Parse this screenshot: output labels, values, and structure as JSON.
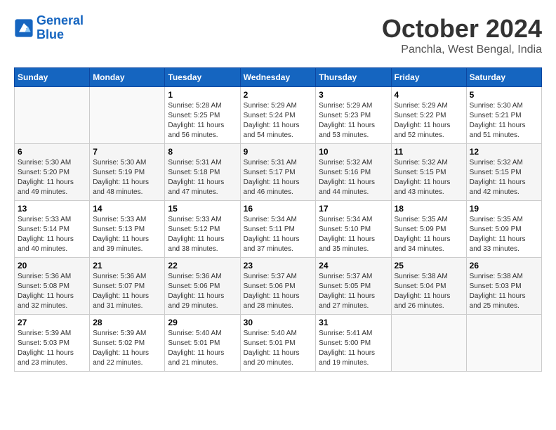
{
  "header": {
    "logo_line1": "General",
    "logo_line2": "Blue",
    "month": "October 2024",
    "location": "Panchla, West Bengal, India"
  },
  "weekdays": [
    "Sunday",
    "Monday",
    "Tuesday",
    "Wednesday",
    "Thursday",
    "Friday",
    "Saturday"
  ],
  "weeks": [
    [
      {
        "day": "",
        "sunrise": "",
        "sunset": "",
        "daylight": ""
      },
      {
        "day": "",
        "sunrise": "",
        "sunset": "",
        "daylight": ""
      },
      {
        "day": "1",
        "sunrise": "Sunrise: 5:28 AM",
        "sunset": "Sunset: 5:25 PM",
        "daylight": "Daylight: 11 hours and 56 minutes."
      },
      {
        "day": "2",
        "sunrise": "Sunrise: 5:29 AM",
        "sunset": "Sunset: 5:24 PM",
        "daylight": "Daylight: 11 hours and 54 minutes."
      },
      {
        "day": "3",
        "sunrise": "Sunrise: 5:29 AM",
        "sunset": "Sunset: 5:23 PM",
        "daylight": "Daylight: 11 hours and 53 minutes."
      },
      {
        "day": "4",
        "sunrise": "Sunrise: 5:29 AM",
        "sunset": "Sunset: 5:22 PM",
        "daylight": "Daylight: 11 hours and 52 minutes."
      },
      {
        "day": "5",
        "sunrise": "Sunrise: 5:30 AM",
        "sunset": "Sunset: 5:21 PM",
        "daylight": "Daylight: 11 hours and 51 minutes."
      }
    ],
    [
      {
        "day": "6",
        "sunrise": "Sunrise: 5:30 AM",
        "sunset": "Sunset: 5:20 PM",
        "daylight": "Daylight: 11 hours and 49 minutes."
      },
      {
        "day": "7",
        "sunrise": "Sunrise: 5:30 AM",
        "sunset": "Sunset: 5:19 PM",
        "daylight": "Daylight: 11 hours and 48 minutes."
      },
      {
        "day": "8",
        "sunrise": "Sunrise: 5:31 AM",
        "sunset": "Sunset: 5:18 PM",
        "daylight": "Daylight: 11 hours and 47 minutes."
      },
      {
        "day": "9",
        "sunrise": "Sunrise: 5:31 AM",
        "sunset": "Sunset: 5:17 PM",
        "daylight": "Daylight: 11 hours and 46 minutes."
      },
      {
        "day": "10",
        "sunrise": "Sunrise: 5:32 AM",
        "sunset": "Sunset: 5:16 PM",
        "daylight": "Daylight: 11 hours and 44 minutes."
      },
      {
        "day": "11",
        "sunrise": "Sunrise: 5:32 AM",
        "sunset": "Sunset: 5:15 PM",
        "daylight": "Daylight: 11 hours and 43 minutes."
      },
      {
        "day": "12",
        "sunrise": "Sunrise: 5:32 AM",
        "sunset": "Sunset: 5:15 PM",
        "daylight": "Daylight: 11 hours and 42 minutes."
      }
    ],
    [
      {
        "day": "13",
        "sunrise": "Sunrise: 5:33 AM",
        "sunset": "Sunset: 5:14 PM",
        "daylight": "Daylight: 11 hours and 40 minutes."
      },
      {
        "day": "14",
        "sunrise": "Sunrise: 5:33 AM",
        "sunset": "Sunset: 5:13 PM",
        "daylight": "Daylight: 11 hours and 39 minutes."
      },
      {
        "day": "15",
        "sunrise": "Sunrise: 5:33 AM",
        "sunset": "Sunset: 5:12 PM",
        "daylight": "Daylight: 11 hours and 38 minutes."
      },
      {
        "day": "16",
        "sunrise": "Sunrise: 5:34 AM",
        "sunset": "Sunset: 5:11 PM",
        "daylight": "Daylight: 11 hours and 37 minutes."
      },
      {
        "day": "17",
        "sunrise": "Sunrise: 5:34 AM",
        "sunset": "Sunset: 5:10 PM",
        "daylight": "Daylight: 11 hours and 35 minutes."
      },
      {
        "day": "18",
        "sunrise": "Sunrise: 5:35 AM",
        "sunset": "Sunset: 5:09 PM",
        "daylight": "Daylight: 11 hours and 34 minutes."
      },
      {
        "day": "19",
        "sunrise": "Sunrise: 5:35 AM",
        "sunset": "Sunset: 5:09 PM",
        "daylight": "Daylight: 11 hours and 33 minutes."
      }
    ],
    [
      {
        "day": "20",
        "sunrise": "Sunrise: 5:36 AM",
        "sunset": "Sunset: 5:08 PM",
        "daylight": "Daylight: 11 hours and 32 minutes."
      },
      {
        "day": "21",
        "sunrise": "Sunrise: 5:36 AM",
        "sunset": "Sunset: 5:07 PM",
        "daylight": "Daylight: 11 hours and 31 minutes."
      },
      {
        "day": "22",
        "sunrise": "Sunrise: 5:36 AM",
        "sunset": "Sunset: 5:06 PM",
        "daylight": "Daylight: 11 hours and 29 minutes."
      },
      {
        "day": "23",
        "sunrise": "Sunrise: 5:37 AM",
        "sunset": "Sunset: 5:06 PM",
        "daylight": "Daylight: 11 hours and 28 minutes."
      },
      {
        "day": "24",
        "sunrise": "Sunrise: 5:37 AM",
        "sunset": "Sunset: 5:05 PM",
        "daylight": "Daylight: 11 hours and 27 minutes."
      },
      {
        "day": "25",
        "sunrise": "Sunrise: 5:38 AM",
        "sunset": "Sunset: 5:04 PM",
        "daylight": "Daylight: 11 hours and 26 minutes."
      },
      {
        "day": "26",
        "sunrise": "Sunrise: 5:38 AM",
        "sunset": "Sunset: 5:03 PM",
        "daylight": "Daylight: 11 hours and 25 minutes."
      }
    ],
    [
      {
        "day": "27",
        "sunrise": "Sunrise: 5:39 AM",
        "sunset": "Sunset: 5:03 PM",
        "daylight": "Daylight: 11 hours and 23 minutes."
      },
      {
        "day": "28",
        "sunrise": "Sunrise: 5:39 AM",
        "sunset": "Sunset: 5:02 PM",
        "daylight": "Daylight: 11 hours and 22 minutes."
      },
      {
        "day": "29",
        "sunrise": "Sunrise: 5:40 AM",
        "sunset": "Sunset: 5:01 PM",
        "daylight": "Daylight: 11 hours and 21 minutes."
      },
      {
        "day": "30",
        "sunrise": "Sunrise: 5:40 AM",
        "sunset": "Sunset: 5:01 PM",
        "daylight": "Daylight: 11 hours and 20 minutes."
      },
      {
        "day": "31",
        "sunrise": "Sunrise: 5:41 AM",
        "sunset": "Sunset: 5:00 PM",
        "daylight": "Daylight: 11 hours and 19 minutes."
      },
      {
        "day": "",
        "sunrise": "",
        "sunset": "",
        "daylight": ""
      },
      {
        "day": "",
        "sunrise": "",
        "sunset": "",
        "daylight": ""
      }
    ]
  ]
}
